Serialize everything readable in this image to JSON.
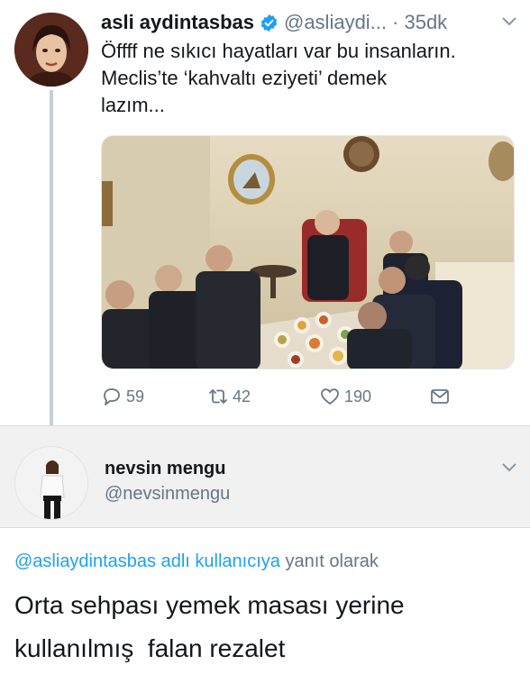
{
  "tweet": {
    "author_name": "asli aydintasbas",
    "author_handle": "@asliaydi...",
    "time": "· 35dk",
    "text_line1": "Öffff ne sıkıcı hayatları var bu insanların.",
    "text_line2": "Meclis’te ‘kahvaltı eziyeti’ demek",
    "text_line3": "lazım...",
    "replies": "59",
    "retweets": "42",
    "likes": "190"
  },
  "reply": {
    "author_name": "nevsin mengu",
    "author_handle": "@nevsinmengu",
    "replying_mention": "@asliaydintasbas adlı kullanıcıya",
    "replying_suffix": " yanıt olarak",
    "text_line1": "Orta sehpası yemek masası yerine",
    "text_line2": "kullanılmış  falan rezalet"
  },
  "colors": {
    "accent": "#1da1f2",
    "secondary_text": "#657786",
    "primary_text": "#14171a"
  }
}
